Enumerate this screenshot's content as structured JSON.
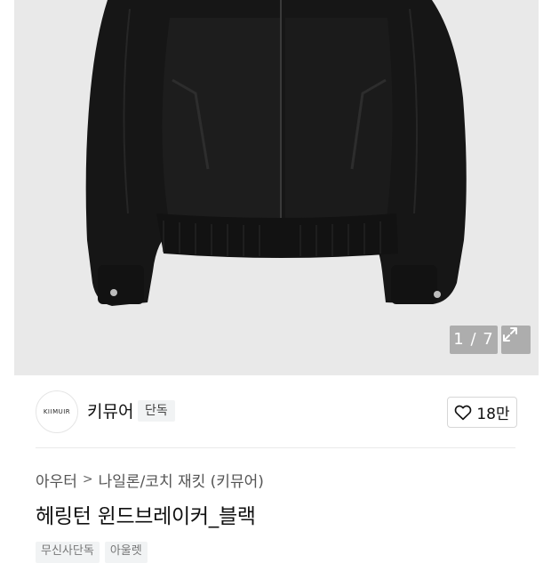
{
  "gallery": {
    "counter": "1 / 7",
    "expand_icon": "expand-icon"
  },
  "brand": {
    "logo_text": "KIIMUIR",
    "name": "키뮤어",
    "badge": "단독"
  },
  "like": {
    "icon": "heart-outline-icon",
    "count": "18만"
  },
  "breadcrumb": {
    "level1": "아우터",
    "separator": ">",
    "level2": "나일론/코치 재킷 (키뮤어)"
  },
  "product": {
    "title": "헤링턴 윈드브레이커_블랙"
  },
  "tags": [
    "무신사단독",
    "아울렛"
  ],
  "colors": {
    "photo_bg": "#e9e9e9",
    "jacket": "#161616",
    "badge_bg": "#f1f3f4"
  }
}
